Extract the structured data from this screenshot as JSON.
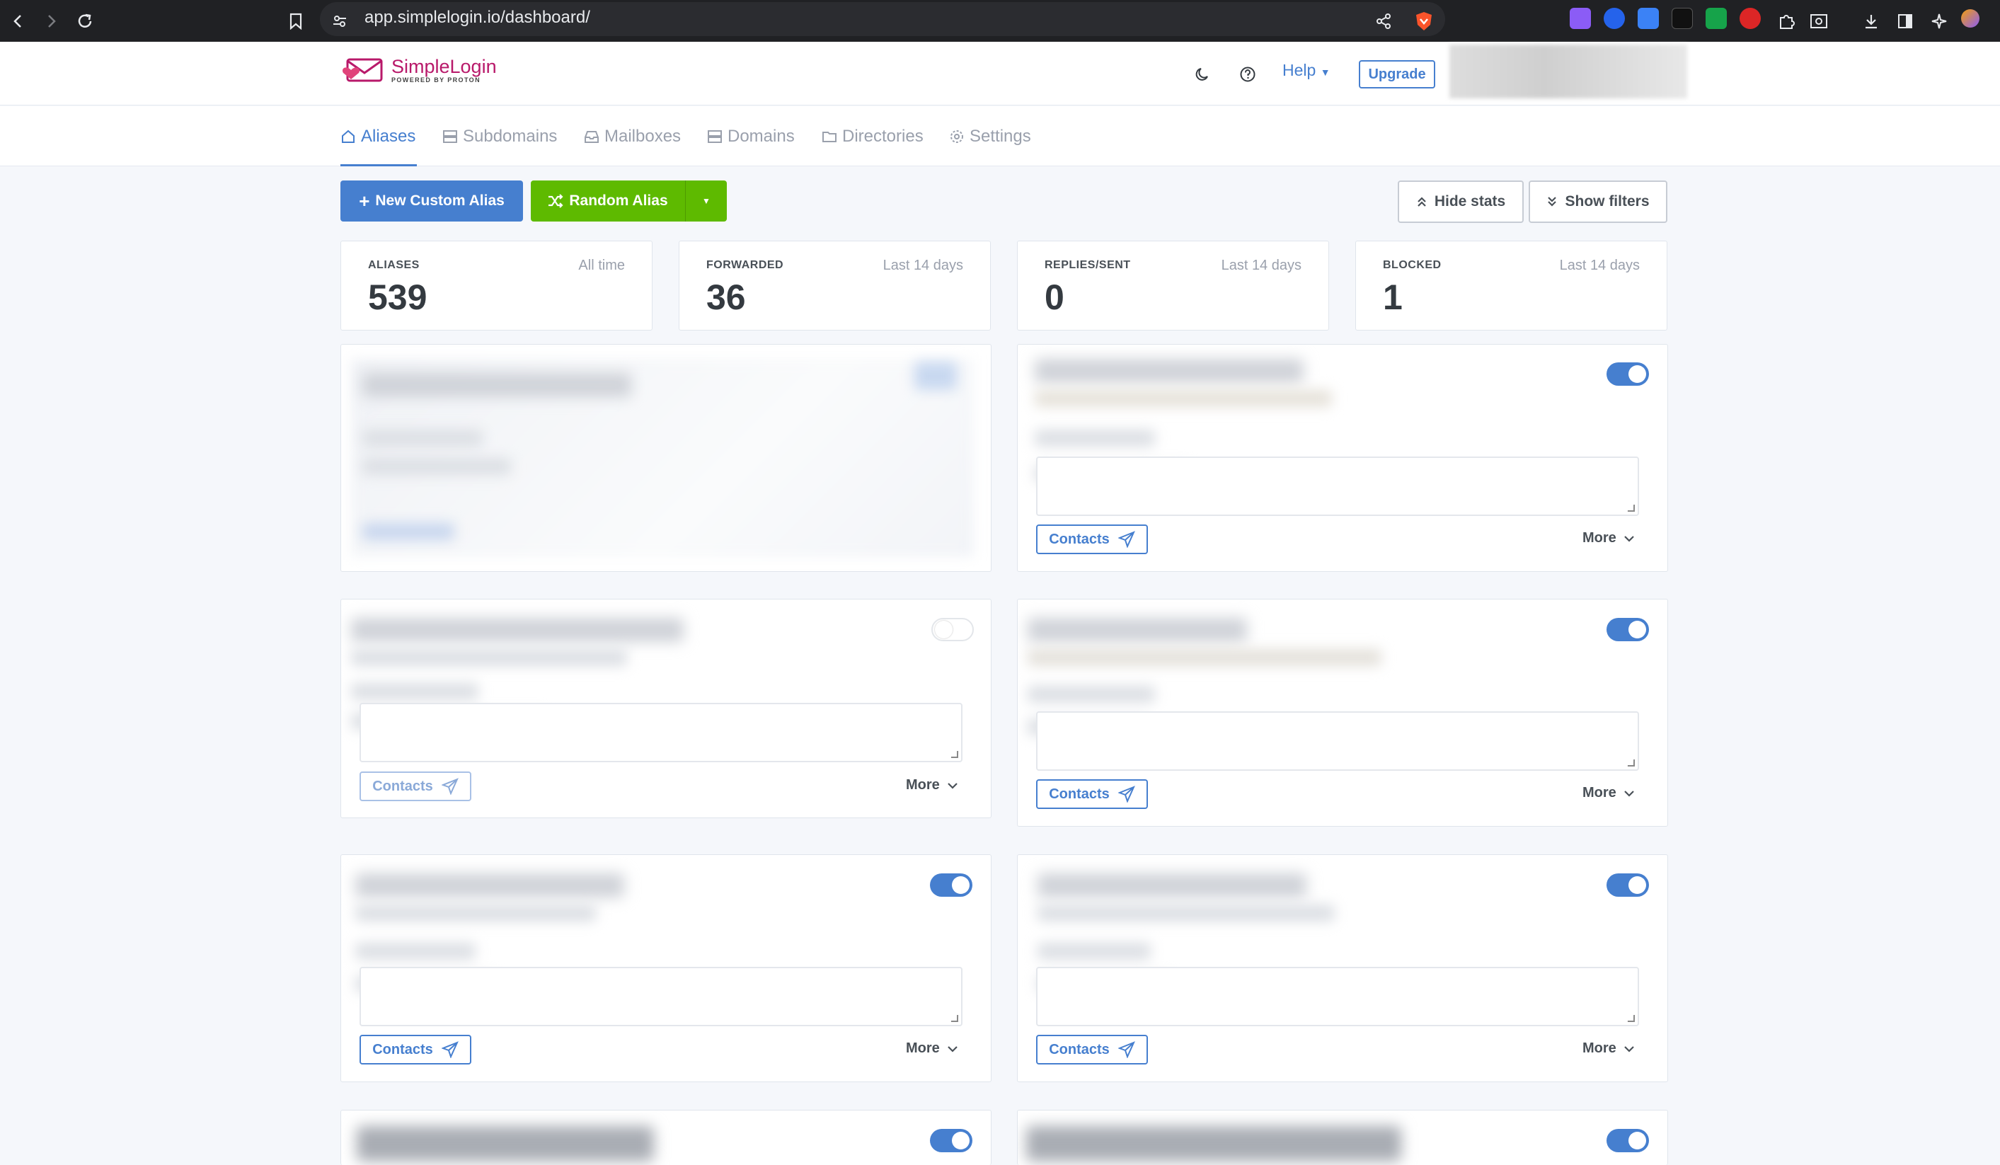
{
  "browser": {
    "url": "app.simplelogin.io/dashboard/"
  },
  "header": {
    "logo_name": "SimpleLogin",
    "logo_sub": "POWERED BY PROTON",
    "help_label": "Help",
    "upgrade_label": "Upgrade"
  },
  "nav": {
    "tabs": [
      {
        "label": "Aliases",
        "icon": "home-icon",
        "active": true
      },
      {
        "label": "Subdomains",
        "icon": "server-icon"
      },
      {
        "label": "Mailboxes",
        "icon": "inbox-icon"
      },
      {
        "label": "Domains",
        "icon": "server-icon"
      },
      {
        "label": "Directories",
        "icon": "folder-icon"
      },
      {
        "label": "Settings",
        "icon": "gear-icon"
      }
    ]
  },
  "actions": {
    "new_custom_alias": "New Custom Alias",
    "random_alias": "Random Alias",
    "hide_stats": "Hide stats",
    "show_filters": "Show filters"
  },
  "stats": [
    {
      "label": "ALIASES",
      "period": "All time",
      "value": "539"
    },
    {
      "label": "FORWARDED",
      "period": "Last 14 days",
      "value": "36"
    },
    {
      "label": "REPLIES/SENT",
      "period": "Last 14 days",
      "value": "0"
    },
    {
      "label": "BLOCKED",
      "period": "Last 14 days",
      "value": "1"
    }
  ],
  "card": {
    "contacts_label": "Contacts",
    "more_label": "More"
  },
  "colors": {
    "primary": "#467fcf",
    "success": "#5eba00",
    "brand": "#b8196a"
  }
}
